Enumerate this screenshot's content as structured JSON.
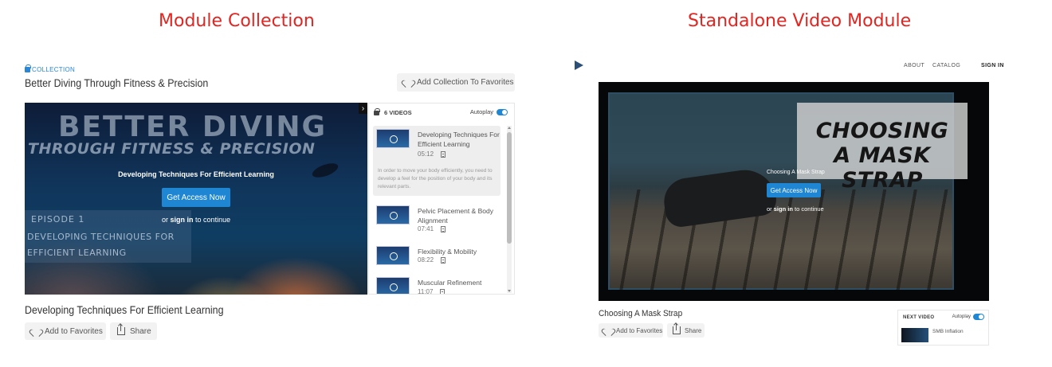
{
  "headings": {
    "left": "Module Collection",
    "right": "Standalone Video Module"
  },
  "collection": {
    "tag": "COLLECTION",
    "title": "Better Diving Through Fitness & Precision",
    "add_favorites_label": "Add Collection To Favorites",
    "hero": {
      "big_title": "BETTER DIVING",
      "sub_title": "THROUGH FITNESS & PRECISION",
      "module_name": "Developing Techniques For Efficient Learning",
      "access_button": "Get Access Now",
      "signin_prefix": "or",
      "signin_link": "sign in",
      "signin_suffix": "to continue",
      "episode_label": "EPISODE 1",
      "episode_title": "DEVELOPING TECHNIQUES FOR EFFICIENT LEARNING",
      "next_arrow": "›"
    },
    "playlist": {
      "count_label": "6 VIDEOS",
      "autoplay_label": "Autoplay",
      "items": [
        {
          "title": "Developing Techniques For Efficient Learning",
          "duration": "05:12",
          "description": "In order to move your body efficiently, you need to develop a feel for the position of your body and its relevant parts."
        },
        {
          "title": "Pelvic Placement & Body Alignment",
          "duration": "07:41"
        },
        {
          "title": "Flexibility & Mobility",
          "duration": "08:22"
        },
        {
          "title": "Muscular Refinement",
          "duration": "11:07"
        }
      ]
    },
    "module_title": "Developing Techniques For Efficient Learning",
    "add_to_favorites": "Add to Favorites",
    "share": "Share"
  },
  "standalone": {
    "nav": {
      "about": "ABOUT",
      "catalog": "CATALOG",
      "signin": "SIGN IN"
    },
    "player": {
      "overlay_line1": "CHOOSING",
      "overlay_line2": "A MASK STRAP",
      "module_name": "Choosing A Mask Strap",
      "access_button": "Get Access Now",
      "signin_prefix": "or",
      "signin_link": "sign in",
      "signin_suffix": "to continue"
    },
    "module_title": "Choosing A Mask Strap",
    "add_to_favorites": "Add to Favorites",
    "share": "Share",
    "next_video": {
      "label": "NEXT VIDEO",
      "autoplay_label": "Autoplay",
      "title": "SMB Inflation"
    }
  },
  "colors": {
    "heading_red": "#e52420",
    "accent_blue": "#1f86d4",
    "collection_tag_blue": "#2a86d6"
  }
}
